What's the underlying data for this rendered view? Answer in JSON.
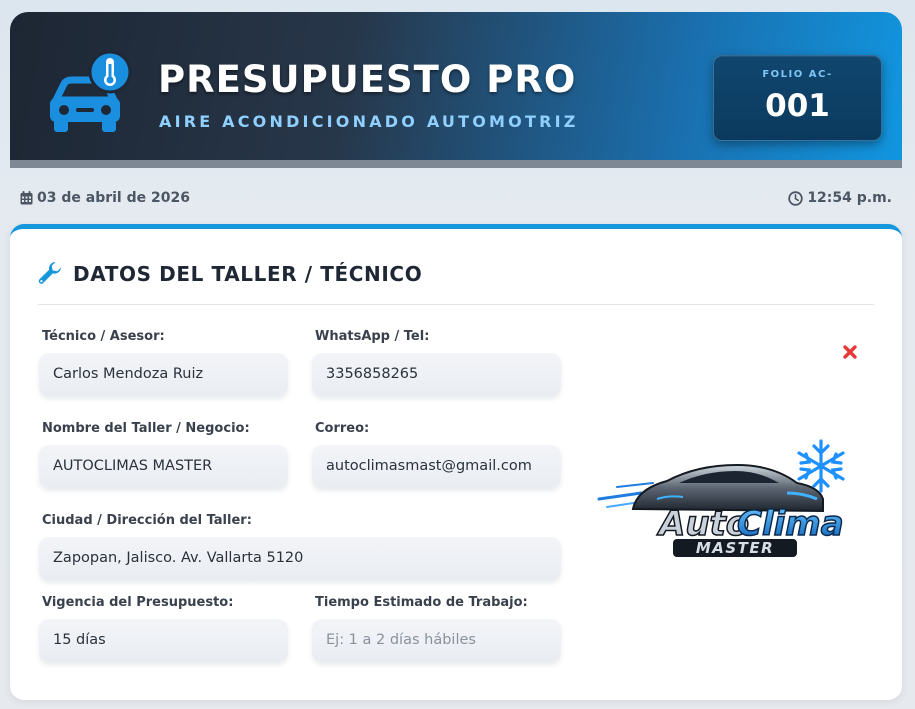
{
  "header": {
    "title": "PRESUPUESTO PRO",
    "subtitle": "AIRE ACONDICIONADO AUTOMOTRIZ",
    "folio_label": "FOLIO AC-",
    "folio_number": "001",
    "icon": "car-ac-icon"
  },
  "meta": {
    "date": "03 de abril de 2026",
    "time": "12:54 p.m.",
    "date_icon": "calendar-icon",
    "time_icon": "clock-icon"
  },
  "section": {
    "title": "DATOS DEL TALLER / TÉCNICO",
    "icon": "wrench-icon"
  },
  "fields": {
    "tecnico": {
      "label": "Técnico / Asesor:",
      "value": "Carlos Mendoza Ruiz",
      "placeholder": ""
    },
    "whatsapp": {
      "label": "WhatsApp / Tel:",
      "value": "3356858265",
      "placeholder": ""
    },
    "taller": {
      "label": "Nombre del Taller / Negocio:",
      "value": "AUTOCLIMAS MASTER",
      "placeholder": ""
    },
    "correo": {
      "label": "Correo:",
      "value": "autoclimasmast@gmail.com",
      "placeholder": ""
    },
    "direccion": {
      "label": "Ciudad / Dirección del Taller:",
      "value": "Zapopan, Jalisco. Av. Vallarta 5120",
      "placeholder": ""
    },
    "vigencia": {
      "label": "Vigencia del Presupuesto:",
      "value": "15 días",
      "placeholder": ""
    },
    "tiempo": {
      "label": "Tiempo Estimado de Trabajo:",
      "value": "",
      "placeholder": "Ej: 1 a 2 días hábiles"
    }
  },
  "logo": {
    "line1_a": "Auto",
    "line1_b": "Clima",
    "line2": "MASTER"
  },
  "colors": {
    "accent": "#1597dc",
    "remove": "#e53935",
    "header_dark": "#1d2633"
  }
}
